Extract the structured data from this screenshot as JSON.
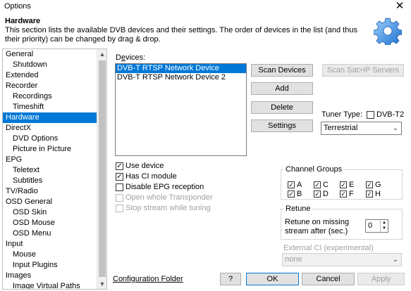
{
  "window": {
    "title": "Options",
    "close": "✕"
  },
  "header": {
    "title": "Hardware",
    "description": "This section lists the available DVB devices and their settings. The order of devices in the list (and thus their priority) can be changed by drag & drop."
  },
  "sidebar": {
    "items": [
      {
        "label": "General",
        "level": 0
      },
      {
        "label": "Shutdown",
        "level": 1
      },
      {
        "label": "Extended",
        "level": 0
      },
      {
        "label": "Recorder",
        "level": 0
      },
      {
        "label": "Recordings",
        "level": 1
      },
      {
        "label": "Timeshift",
        "level": 1
      },
      {
        "label": "Hardware",
        "level": 0,
        "selected": true
      },
      {
        "label": "DirectX",
        "level": 0
      },
      {
        "label": "DVD Options",
        "level": 1
      },
      {
        "label": "Picture in Picture",
        "level": 1
      },
      {
        "label": "EPG",
        "level": 0
      },
      {
        "label": "Teletext",
        "level": 1
      },
      {
        "label": "Subtitles",
        "level": 1
      },
      {
        "label": "TV/Radio",
        "level": 0
      },
      {
        "label": "OSD General",
        "level": 0
      },
      {
        "label": "OSD Skin",
        "level": 1
      },
      {
        "label": "OSD Mouse",
        "level": 1
      },
      {
        "label": "OSD Menu",
        "level": 1
      },
      {
        "label": "Input",
        "level": 0
      },
      {
        "label": "Mouse",
        "level": 1
      },
      {
        "label": "Input Plugins",
        "level": 1
      },
      {
        "label": "Images",
        "level": 0
      },
      {
        "label": "Image Virtual Paths",
        "level": 1
      }
    ]
  },
  "devices": {
    "label_pre": "D",
    "label_u": "e",
    "label_post": "vices:",
    "items": [
      {
        "label": "DVB-T RTSP Network Device",
        "selected": true
      },
      {
        "label": "DVB-T RTSP Network Device 2",
        "selected": false
      }
    ]
  },
  "buttons": {
    "scan_devices": "Scan Devices",
    "scan_sat_ip": "Scan Sat>IP Servers",
    "add": "Add",
    "delete": "Delete",
    "settings": "Settings"
  },
  "tuner": {
    "label": "Tuner Type:",
    "dvbt2_label": "DVB-T2",
    "dvbt2_checked": false,
    "selected": "Terrestrial"
  },
  "options": {
    "use_device": {
      "label": "Use device",
      "checked": true
    },
    "has_ci": {
      "label": "Has CI module",
      "checked": true
    },
    "disable_epg": {
      "label": "Disable EPG reception",
      "checked": false
    },
    "open_whole": {
      "label": "Open whole Transponder",
      "checked": false
    },
    "stop_stream": {
      "label": "Stop stream while tuning",
      "checked": false
    }
  },
  "channel_groups": {
    "title": "Channel Groups",
    "items": [
      {
        "label": "A",
        "checked": true
      },
      {
        "label": "C",
        "checked": true
      },
      {
        "label": "E",
        "checked": true
      },
      {
        "label": "G",
        "checked": true
      },
      {
        "label": "B",
        "checked": true
      },
      {
        "label": "D",
        "checked": true
      },
      {
        "label": "F",
        "checked": true
      },
      {
        "label": "H",
        "checked": true
      }
    ]
  },
  "retune": {
    "title": "Retune",
    "label_line1": "Retune on missing",
    "label_line2": "stream after (sec.)",
    "value": "0"
  },
  "external_ci": {
    "label": "External CI (experimental)",
    "selected": "none"
  },
  "footer": {
    "config_folder": "Configuration Folder",
    "help": "?",
    "ok": "OK",
    "cancel": "Cancel",
    "apply": "Apply"
  },
  "colors": {
    "selection": "#0078d7",
    "button_face": "#e1e1e1",
    "disabled_text": "#a0a0a0"
  }
}
